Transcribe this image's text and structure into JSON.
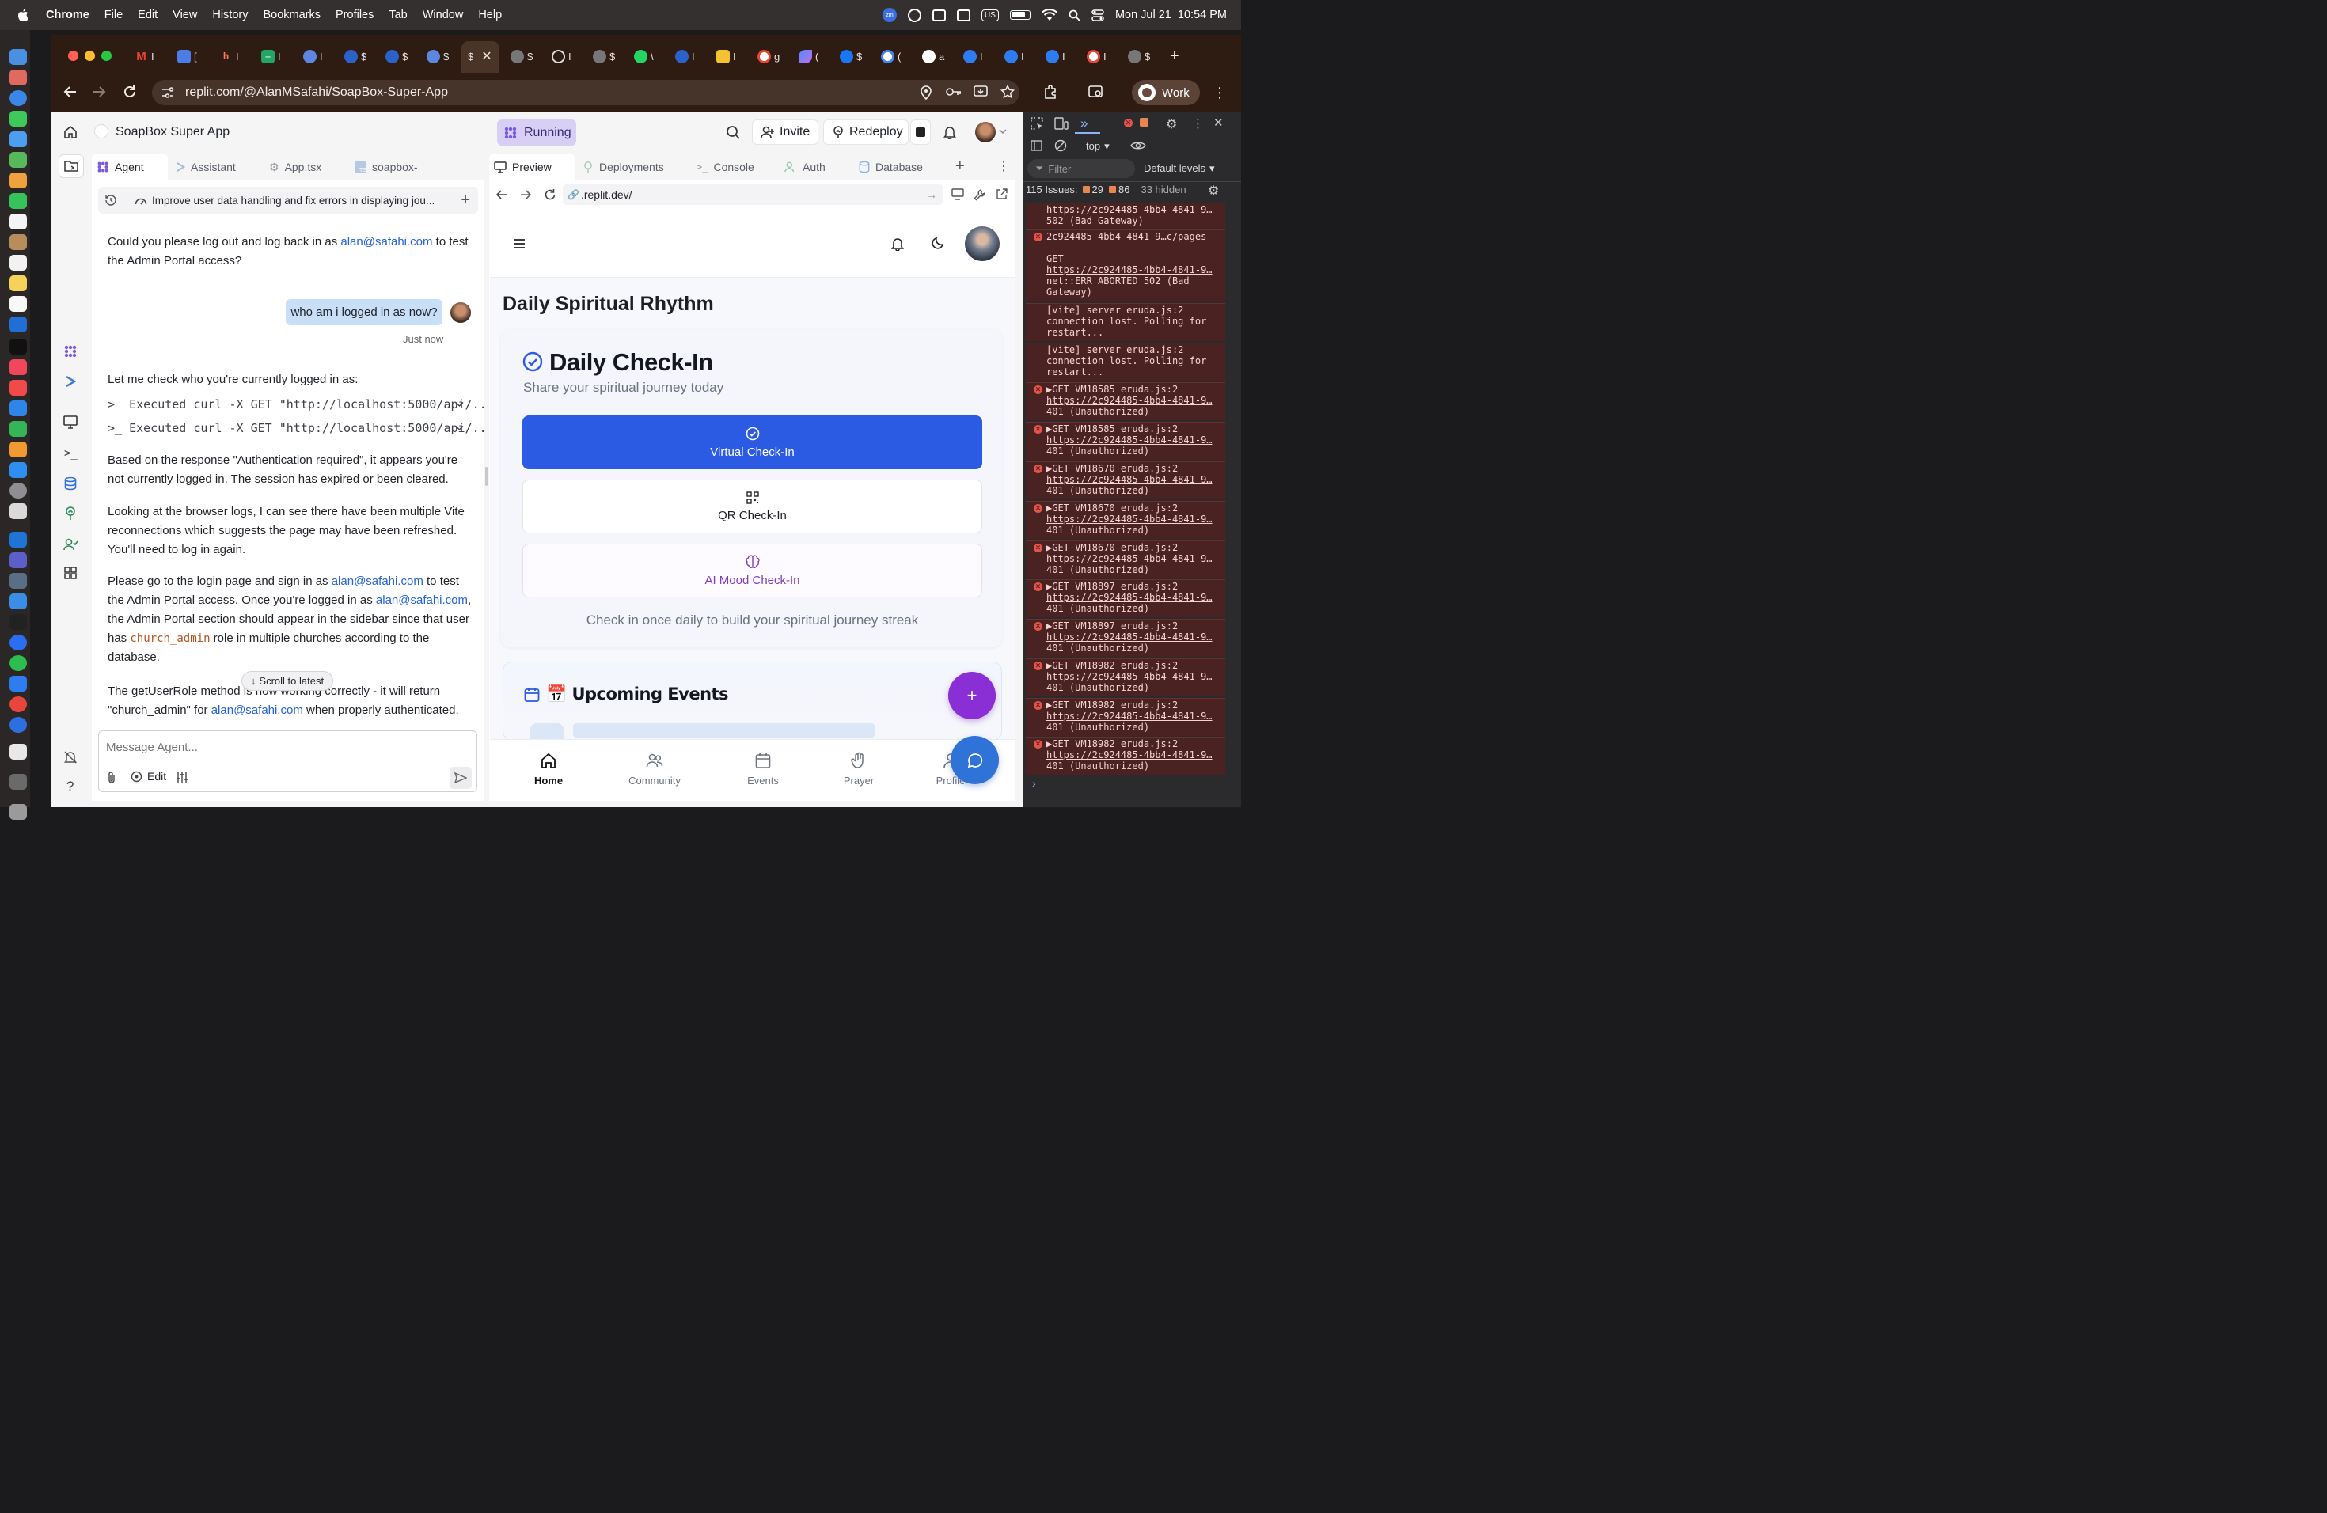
{
  "menubar": {
    "apple": "",
    "app": "Chrome",
    "items": [
      "File",
      "Edit",
      "View",
      "History",
      "Bookmarks",
      "Profiles",
      "Tab",
      "Window",
      "Help"
    ],
    "input_source": "US",
    "datetime": "Mon Jul 21  10:54 PM"
  },
  "browser": {
    "tabs_favicon_labels": [
      "M",
      "[",
      "h",
      "+",
      "≡",
      "⊘",
      "⊘",
      "≡",
      "$"
    ],
    "url": "replit.com/@AlanMSafahi/SoapBox-Super-App",
    "profile_label": "Work"
  },
  "replit": {
    "project_name": "SoapBox Super App",
    "run_status": "Running",
    "invite_label": "Invite",
    "redeploy_label": "Redeploy",
    "left_tabs": [
      {
        "label": "Agent"
      },
      {
        "label": "Assistant"
      },
      {
        "label": "App.tsx"
      },
      {
        "label": "soapbox-"
      }
    ],
    "right_tabs": [
      {
        "label": "Preview"
      },
      {
        "label": "Deployments"
      },
      {
        "label": "Console"
      },
      {
        "label": "Auth"
      },
      {
        "label": "Database"
      }
    ],
    "task_title": "Improve user data handling and fix errors in displaying jou...",
    "messages": {
      "m1_a": "Could you please log out and log back in as ",
      "m1_link": "alan@safahi.com",
      "m1_b": " to test the Admin Portal access?",
      "user_msg": "who am i logged in as now?",
      "user_time": "Just now",
      "m2": "Let me check who you're currently logged in as:",
      "exec1": ">_ Executed curl -X GET \"http://localhost:5000/api/...",
      "exec2": ">_ Executed curl -X GET \"http://localhost:5000/api/...",
      "m3": "Based on the response \"Authentication required\", it appears you're not currently logged in. The session has expired or been cleared.",
      "m4": "Looking at the browser logs, I can see there have been multiple Vite reconnections which suggests the page may have been refreshed. You'll need to log in again.",
      "m5_a": "Please go to the login page and sign in as ",
      "m5_link1": "alan@safahi.com",
      "m5_b": " to test the Admin Portal access. Once you're logged in as ",
      "m5_link2": "alan@safahi.com",
      "m5_c": ", the Admin Portal section should appear in the sidebar since that user has ",
      "m5_code": "church_admin",
      "m5_d": " role in multiple churches according to the database.",
      "m6_a": "The getUserRole method is now working correctly - it will return \"church_admin\" for ",
      "m6_link": "alan@safahi.com",
      "m6_b": " when properly authenticated."
    },
    "scroll_latest": "Scroll to latest",
    "input_placeholder": "Message Agent...",
    "edit_label": "Edit",
    "preview_url": ".replit.dev/"
  },
  "app_preview": {
    "page_title": "Daily Spiritual Rhythm",
    "checkin_title": "Daily Check-In",
    "checkin_subtitle": "Share your spiritual journey today",
    "virtual_label": "Virtual Check-In",
    "qr_label": "QR Check-In",
    "ai_label": "AI Mood Check-In",
    "streak_text": "Check in once daily to build your spiritual journey streak",
    "events_title": "📅 Upcoming Events",
    "nav": [
      {
        "label": "Home",
        "icon": "home-icon"
      },
      {
        "label": "Community",
        "icon": "community-icon"
      },
      {
        "label": "Events",
        "icon": "calendar-icon"
      },
      {
        "label": "Prayer",
        "icon": "hand-icon"
      },
      {
        "label": "Profile",
        "icon": "user-icon"
      }
    ],
    "colors": {
      "primary": "#2c5be3",
      "ai_purple": "#7e3fb8",
      "fab": "#8a2fd6",
      "chat_fab": "#2f73d9"
    }
  },
  "devtools": {
    "context": "top",
    "filter_placeholder": "Filter",
    "levels": "Default levels",
    "issues": "115 Issues:",
    "issue_errors": "29",
    "issue_warnings": "86",
    "hidden": "33 hidden",
    "logs": [
      {
        "type": "error-cont",
        "lines": [
          "https://2c924485-4bb4-4841-9…",
          "502 (Bad Gateway)"
        ]
      },
      {
        "type": "error",
        "lines": [
          "2c924485-4bb4-4841-9…c/pages",
          "",
          "GET",
          "https://2c924485-4bb4-4841-9…",
          "net::ERR_ABORTED 502 (Bad",
          "Gateway)"
        ]
      },
      {
        "type": "warn",
        "lines": [
          "[vite] server     eruda.js:2",
          "connection lost. Polling for",
          "restart..."
        ]
      },
      {
        "type": "warn",
        "lines": [
          "[vite] server     eruda.js:2",
          "connection lost. Polling for",
          "restart..."
        ]
      },
      {
        "type": "error",
        "lines": [
          "▶GET  VM18585 eruda.js:2",
          "https://2c924485-4bb4-4841-9…",
          "401 (Unauthorized)"
        ]
      },
      {
        "type": "error",
        "lines": [
          "▶GET  VM18585 eruda.js:2",
          "https://2c924485-4bb4-4841-9…",
          "401 (Unauthorized)"
        ]
      },
      {
        "type": "error",
        "lines": [
          "▶GET  VM18670 eruda.js:2",
          "https://2c924485-4bb4-4841-9…",
          "401 (Unauthorized)"
        ]
      },
      {
        "type": "error",
        "lines": [
          "▶GET  VM18670 eruda.js:2",
          "https://2c924485-4bb4-4841-9…",
          "401 (Unauthorized)"
        ]
      },
      {
        "type": "error",
        "lines": [
          "▶GET  VM18670 eruda.js:2",
          "https://2c924485-4bb4-4841-9…",
          "401 (Unauthorized)"
        ]
      },
      {
        "type": "error",
        "lines": [
          "▶GET  VM18897 eruda.js:2",
          "https://2c924485-4bb4-4841-9…",
          "401 (Unauthorized)"
        ]
      },
      {
        "type": "error",
        "lines": [
          "▶GET  VM18897 eruda.js:2",
          "https://2c924485-4bb4-4841-9…",
          "401 (Unauthorized)"
        ]
      },
      {
        "type": "error",
        "lines": [
          "▶GET  VM18982 eruda.js:2",
          "https://2c924485-4bb4-4841-9…",
          "401 (Unauthorized)"
        ]
      },
      {
        "type": "error",
        "lines": [
          "▶GET  VM18982 eruda.js:2",
          "https://2c924485-4bb4-4841-9…",
          "401 (Unauthorized)"
        ]
      },
      {
        "type": "error",
        "lines": [
          "▶GET  VM18982 eruda.js:2",
          "https://2c924485-4bb4-4841-9…",
          "401 (Unauthorized)"
        ]
      }
    ]
  }
}
